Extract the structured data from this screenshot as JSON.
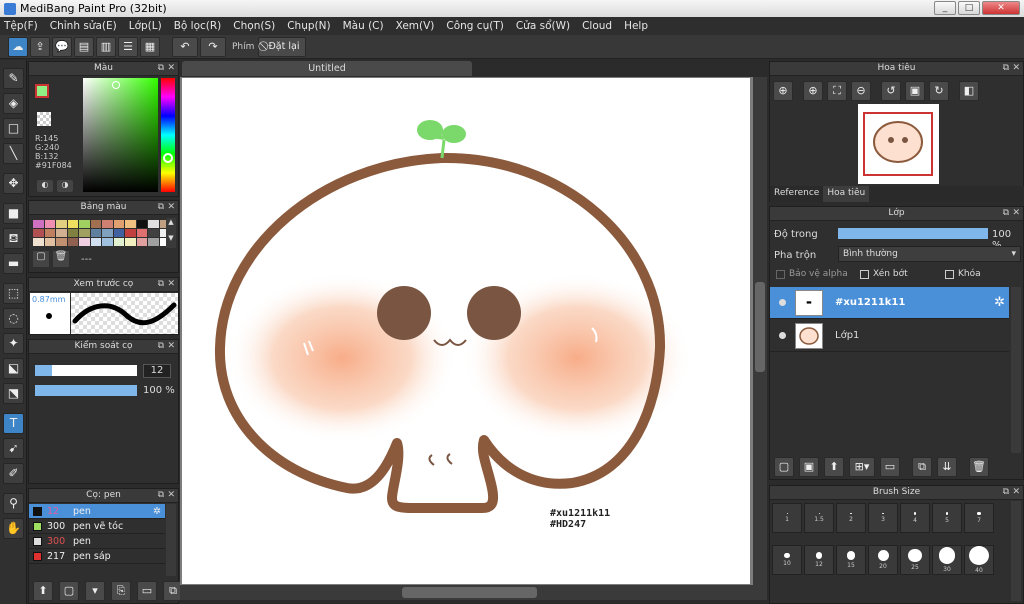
{
  "window": {
    "title": "MediBang Paint Pro (32bit)",
    "min": "_",
    "max": "□",
    "close": "✕"
  },
  "menu": [
    "Tệp(F)",
    "Chỉnh sửa(E)",
    "Lớp(L)",
    "Bộ lọc(R)",
    "Chọn(S)",
    "Chụp(N)",
    "Màu (C)",
    "Xem(V)",
    "Công cụ(T)",
    "Cửa sổ(W)",
    "Cloud",
    "Help"
  ],
  "toolbar": {
    "key_label": "Phím",
    "reset_label": "Đặt lại"
  },
  "color_panel": {
    "title": "Màu",
    "r": "R:145",
    "g": "G:240",
    "b": "B:132",
    "hex": "#91F084",
    "fg": "#91F084"
  },
  "palette_panel": {
    "title": "Bảng màu",
    "dash": "---",
    "colors": [
      "#d070c0",
      "#f090b0",
      "#e0d080",
      "#f0e060",
      "#a0d060",
      "#a07050",
      "#d08070",
      "#e0a070",
      "#f0c080",
      "#111111",
      "#e0e0e0",
      "#c0a080",
      "#b05050",
      "#c08060",
      "#d0b090",
      "#808040",
      "#a0a060",
      "#6080a0",
      "#80a0c0",
      "#4060a0",
      "#c04040",
      "#e07070",
      "#404040",
      "#f0f0f0",
      "#f0e0d0",
      "#e0c0a0",
      "#c09070",
      "#906050",
      "#f0d0e0",
      "#d0e0f0",
      "#a0c0e0",
      "#e0f0d0",
      "#f0f0c0",
      "#e0a0a0",
      "#a0a0a0",
      "#ffffff"
    ]
  },
  "brush_preview": {
    "title": "Xem trước cọ",
    "size": "0.87mm"
  },
  "brush_control": {
    "title": "Kiểm soát cọ",
    "size_value": "12",
    "size_fill": 0.17,
    "opacity_value": "100 %",
    "opacity_fill": 1.0
  },
  "brush_panel": {
    "title": "Cọ: pen",
    "items": [
      {
        "num": "12",
        "name": "pen",
        "color": "#111111",
        "num_color": "#e060a0"
      },
      {
        "num": "300",
        "name": "pen vẽ tóc",
        "color": "#a0e060",
        "num_color": "#eeeeee"
      },
      {
        "num": "300",
        "name": "pen",
        "color": "#dddddd",
        "num_color": "#e05050"
      },
      {
        "num": "217",
        "name": "pen sáp",
        "color": "#e03030",
        "num_color": "#eeeeee"
      }
    ]
  },
  "canvas": {
    "tab": "Untitled",
    "watermark_1": "#xu1211k11",
    "watermark_2": "#HD247"
  },
  "navigator": {
    "title": "Hoa tiêu",
    "tab_reference": "Reference",
    "tab_navigator": "Hoa tiêu"
  },
  "layer_panel": {
    "title": "Lớp",
    "opacity_label": "Độ trong",
    "opacity_value": "100 %",
    "opacity_fill": 1.0,
    "blend_label": "Pha trộn",
    "blend_value": "Bình thường",
    "protect_alpha": "Bảo vệ alpha",
    "clip": "Xén bớt",
    "lock": "Khóa",
    "layers": [
      {
        "name": "#xu1211k11"
      },
      {
        "name": "Lớp1"
      }
    ]
  },
  "brush_size_panel": {
    "title": "Brush Size",
    "sizes": [
      "1",
      "1.5",
      "2",
      "3",
      "4",
      "5",
      "7",
      "10",
      "12",
      "15",
      "20",
      "25",
      "30",
      "40"
    ]
  }
}
